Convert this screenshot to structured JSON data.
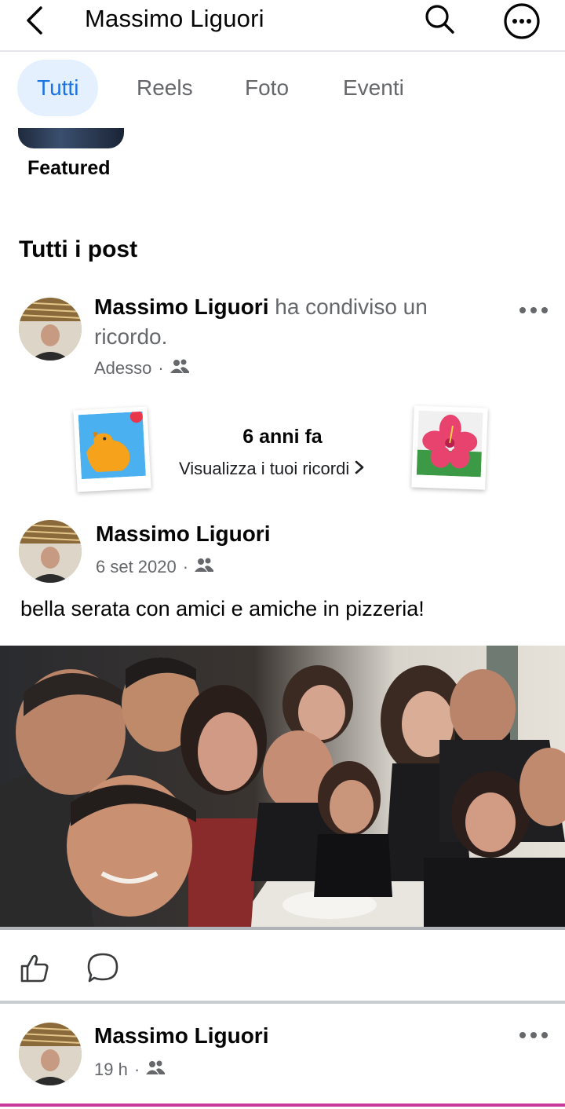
{
  "header": {
    "title": "Massimo Liguori"
  },
  "tabs": [
    {
      "label": "Tutti",
      "active": true
    },
    {
      "label": "Reels",
      "active": false
    },
    {
      "label": "Foto",
      "active": false
    },
    {
      "label": "Eventi",
      "active": false
    }
  ],
  "featured": {
    "label": "Featured"
  },
  "section": {
    "title": "Tutti i post"
  },
  "post1": {
    "author": "Massimo Liguori",
    "action": " ha condiviso un ricordo.",
    "time": "Adesso",
    "memory": {
      "title": "6 anni fa",
      "link": "Visualizza i tuoi ricordi"
    }
  },
  "post2": {
    "author": "Massimo Liguori",
    "time": "6 set 2020",
    "text": "bella serata con amici e amiche in pizzeria!"
  },
  "post3": {
    "author": "Massimo Liguori",
    "time": "19 h"
  },
  "icons": {
    "back": "back-arrow-icon",
    "search": "search-icon",
    "more": "more-options-icon",
    "audience": "friends-audience-icon",
    "like": "like-icon",
    "comment": "comment-icon"
  },
  "colors": {
    "accent": "#1b74e4",
    "active_tab_bg": "#e4f0fd",
    "secondary_text": "#65676b"
  }
}
